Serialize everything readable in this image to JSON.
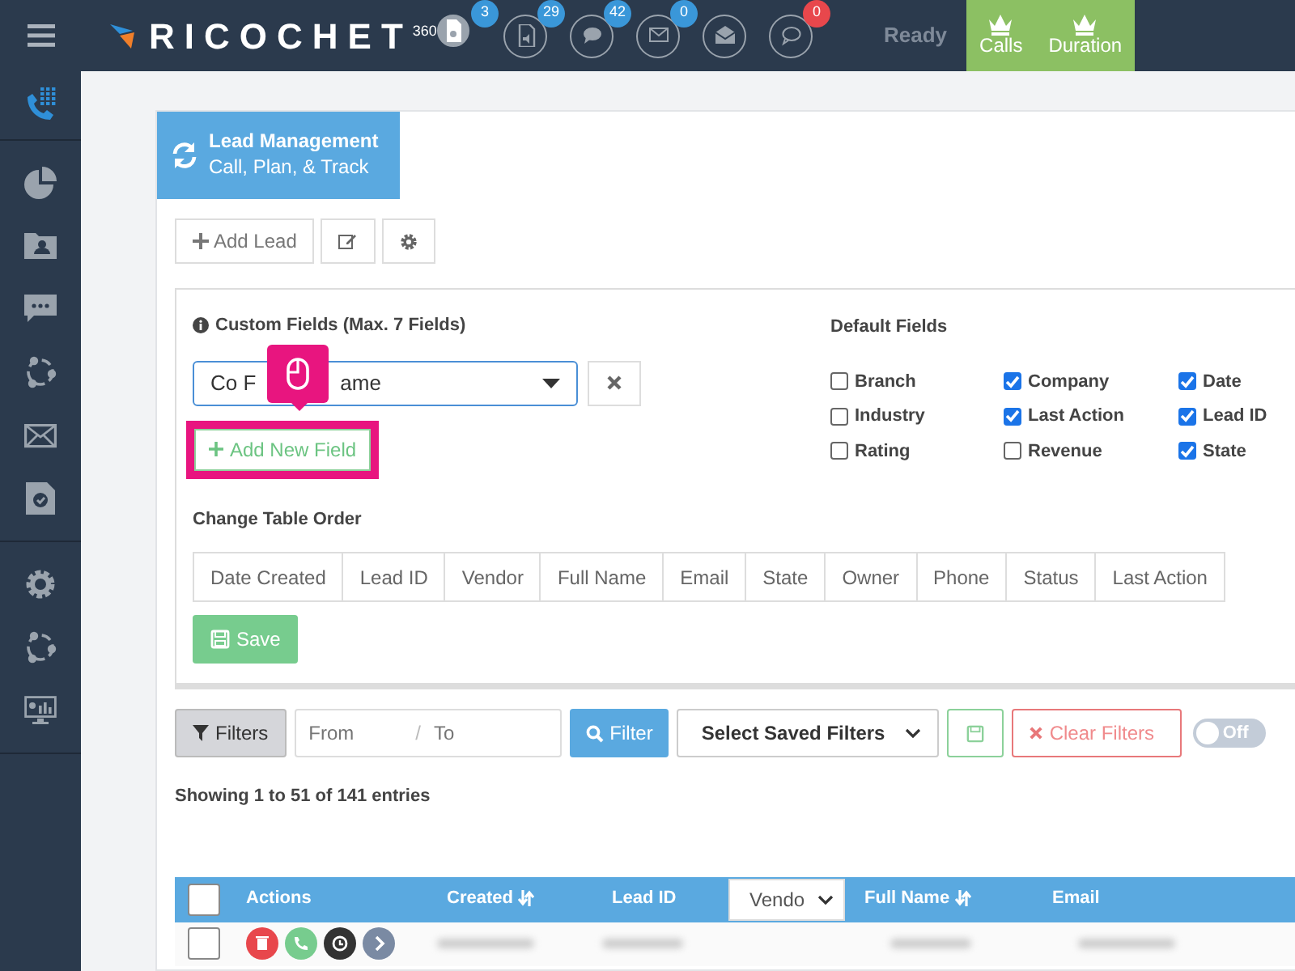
{
  "topbar": {
    "logo_text": "RICOCHET",
    "logo_sup": "360",
    "notifications": [
      {
        "kind": "document",
        "active": true,
        "count": "3",
        "color": "#3a97d9"
      },
      {
        "kind": "audio-file",
        "active": false,
        "count": "29",
        "color": "#3a97d9"
      },
      {
        "kind": "chat",
        "active": false,
        "count": "42",
        "color": "#3a97d9"
      },
      {
        "kind": "envelope",
        "active": false,
        "count": "0",
        "color": "#3a97d9"
      },
      {
        "kind": "open-envelope",
        "active": false
      },
      {
        "kind": "speech",
        "active": false,
        "count": "0",
        "color": "#e8474c"
      }
    ],
    "status": "Ready",
    "stats": [
      {
        "label": "Calls"
      },
      {
        "label": "Duration"
      }
    ]
  },
  "sidebar": {
    "groups": [
      [
        {
          "kind": "dialpad",
          "selected": true
        }
      ],
      [
        {
          "kind": "pie",
          "selected": false
        },
        {
          "kind": "contact-folder",
          "selected": false
        },
        {
          "kind": "chat",
          "selected": false
        },
        {
          "kind": "network",
          "selected": false
        },
        {
          "kind": "envelope",
          "selected": false
        },
        {
          "kind": "task",
          "selected": false
        }
      ],
      [
        {
          "kind": "gear",
          "selected": false
        },
        {
          "kind": "network",
          "selected": false
        },
        {
          "kind": "monitor",
          "selected": false
        }
      ]
    ]
  },
  "panel": {
    "title": "Lead Management",
    "subtitle": "Call, Plan, & Track"
  },
  "toolbar": {
    "add_lead": "Add Lead"
  },
  "custom_fields": {
    "title": "Custom Fields (Max. 7 Fields)",
    "value_parts": [
      "Co F",
      "ame"
    ],
    "add_button": "Add New Field",
    "highlighted": true
  },
  "default_fields": {
    "title": "Default Fields",
    "items": [
      {
        "label": "Branch",
        "checked": false
      },
      {
        "label": "Company",
        "checked": true
      },
      {
        "label": "Date",
        "checked": true
      },
      {
        "label": "Industry",
        "checked": false
      },
      {
        "label": "Last Action",
        "checked": true
      },
      {
        "label": "Lead ID",
        "checked": true
      },
      {
        "label": "Rating",
        "checked": false
      },
      {
        "label": "Revenue",
        "checked": false
      },
      {
        "label": "State",
        "checked": true
      }
    ]
  },
  "table_order": {
    "title": "Change Table Order",
    "items": [
      "Date Created",
      "Lead ID",
      "Vendor",
      "Full Name",
      "Email",
      "State",
      "Owner",
      "Phone",
      "Status",
      "Last Action"
    ],
    "save": "Save"
  },
  "filters": {
    "button": "Filters",
    "from_placeholder": "From",
    "separator": "/",
    "to_placeholder": "To",
    "filter": "Filter",
    "saved": "Select Saved Filters",
    "clear": "Clear Filters",
    "toggle": {
      "label": "Off",
      "on": false
    }
  },
  "showing": "Showing 1 to 51 of 141 entries",
  "table": {
    "header_checked": false,
    "columns": [
      {
        "kind": "text",
        "label": "Actions"
      },
      {
        "kind": "sortable",
        "label": "Created"
      },
      {
        "kind": "text",
        "label": "Lead ID"
      },
      {
        "kind": "select",
        "label": "Vendo"
      },
      {
        "kind": "sortable",
        "label": "Full Name"
      },
      {
        "kind": "text",
        "label": "Email"
      }
    ],
    "rows": [
      {
        "checked": false
      }
    ]
  }
}
